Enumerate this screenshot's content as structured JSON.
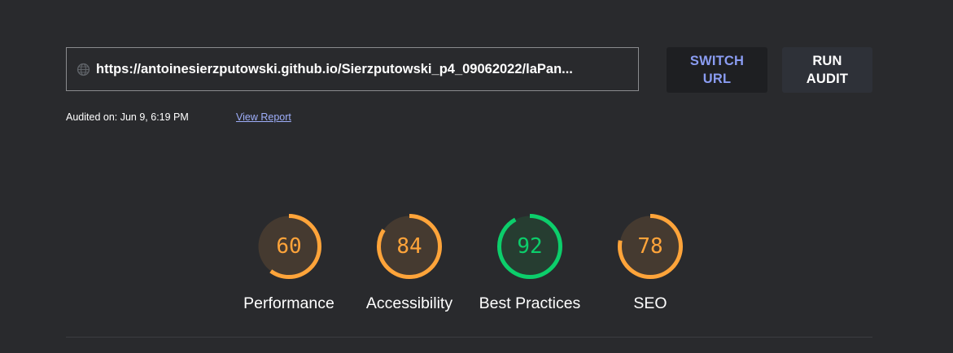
{
  "header": {
    "url": "https://antoinesierzputowski.github.io/Sierzputowski_p4_09062022/laPan...",
    "url_icon": "globe-icon",
    "switch_url_line1": "SWITCH",
    "switch_url_line2": "URL",
    "run_audit_line1": "RUN",
    "run_audit_line2": "AUDIT"
  },
  "audit": {
    "audited_on": "Audited on: Jun 9, 6:19 PM",
    "view_report": "View Report"
  },
  "colors": {
    "average": "#ffa43a",
    "average_fill": "#453a30",
    "pass": "#0cce6b",
    "pass_fill": "#263d31"
  },
  "gauges": [
    {
      "label": "Performance",
      "score": 60,
      "rating": "average"
    },
    {
      "label": "Accessibility",
      "score": 84,
      "rating": "average"
    },
    {
      "label": "Best Practices",
      "score": 92,
      "rating": "pass"
    },
    {
      "label": "SEO",
      "score": 78,
      "rating": "average"
    }
  ]
}
